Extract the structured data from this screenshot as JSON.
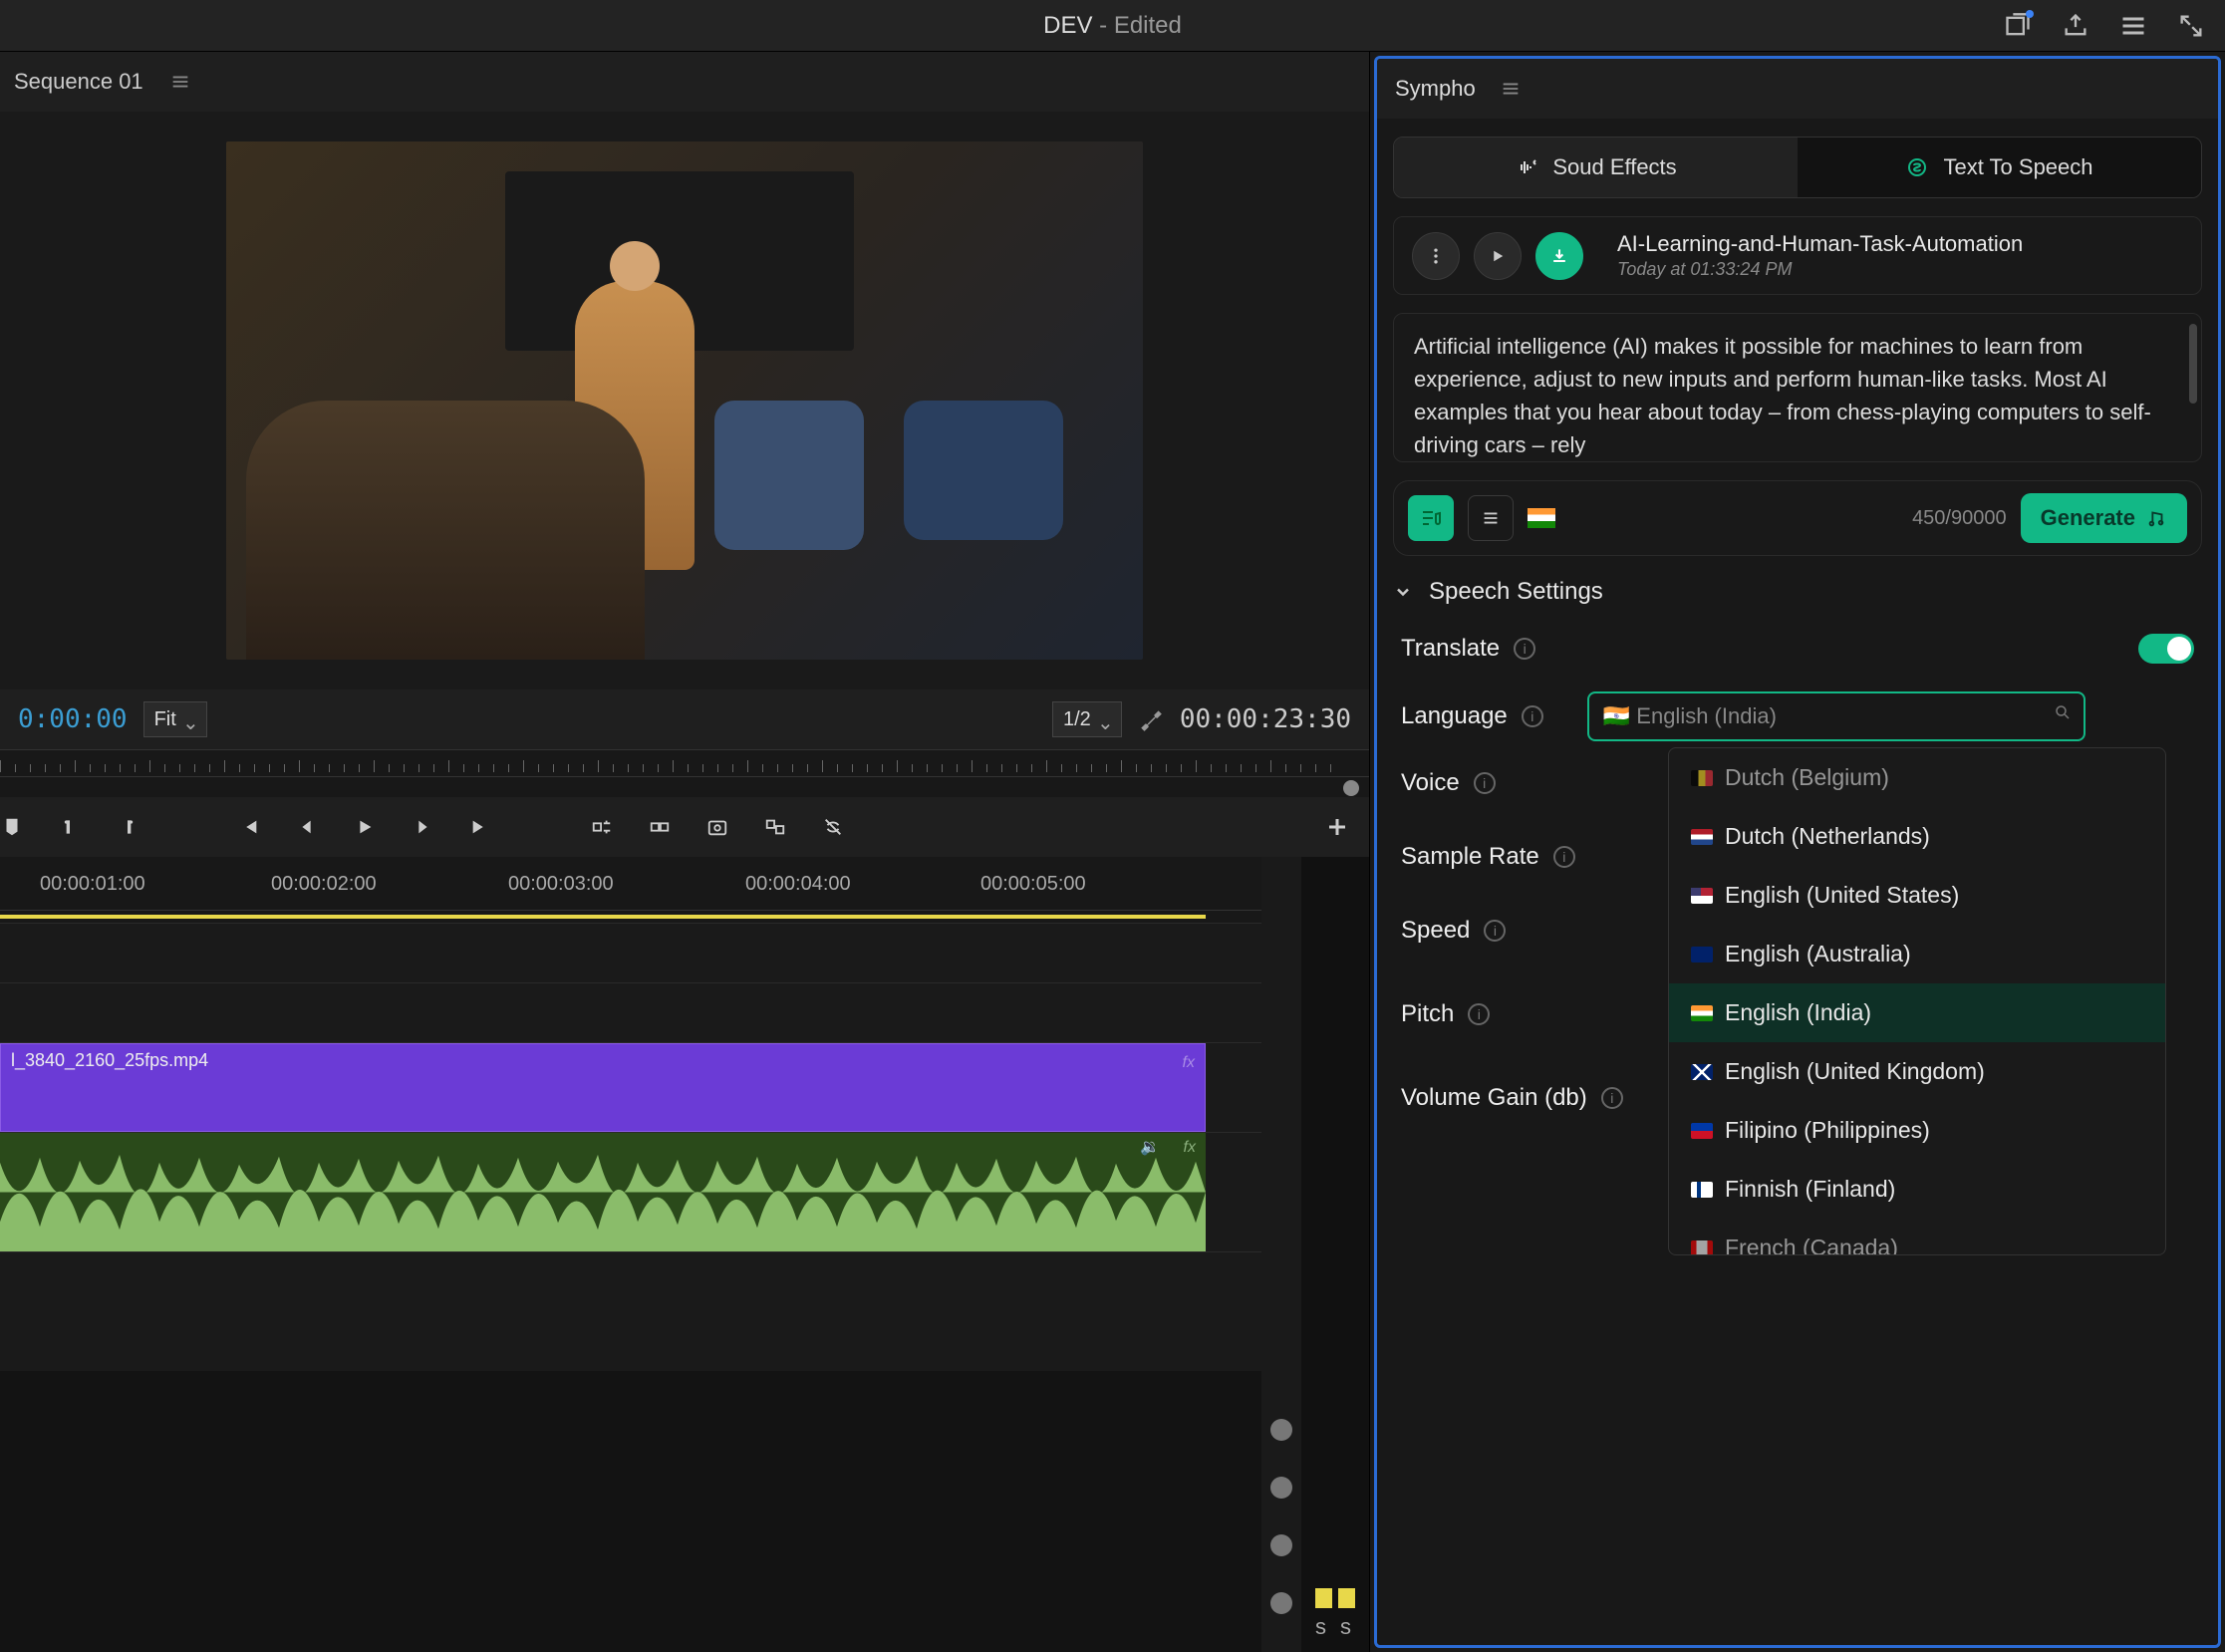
{
  "title": {
    "primary": "DEV",
    "suffix": " - Edited"
  },
  "left": {
    "sequence_label": "Sequence 01",
    "tc_start": "0:00:00",
    "fit_label": "Fit",
    "page_label": "1/2",
    "tc_end": "00:00:23:30",
    "time_labels": [
      "00:00:01:00",
      "00:00:02:00",
      "00:00:03:00",
      "00:00:04:00",
      "00:00:05:00"
    ],
    "video_clip_name": "l_3840_2160_25fps.mp4",
    "fx_label": "fx",
    "vu_label": "s  s"
  },
  "panel": {
    "name": "Sympho",
    "tabs": {
      "sound_effects": "Soud Effects",
      "tts": "Text To Speech"
    },
    "asset": {
      "title": "AI-Learning-and-Human-Task-Automation",
      "time": "Today at 01:33:24 PM"
    },
    "body_text": "Artificial intelligence (AI) makes it possible for machines to learn from experience, adjust to new inputs and perform human-like tasks. Most AI examples that you hear about today – from chess-playing computers to self-driving cars – rely",
    "char_count": "450/90000",
    "generate_label": "Generate",
    "speech_settings": "Speech Settings",
    "translate": "Translate",
    "language": "Language",
    "lang_value": "🇮🇳 English (India)",
    "voice": "Voice",
    "sample_rate": "Sample Rate",
    "speed": "Speed",
    "pitch": "Pitch",
    "volume_gain": "Volume Gain (db)",
    "lang_options": [
      {
        "flag": "be",
        "label": "Dutch (Belgium)",
        "cut": true
      },
      {
        "flag": "nl",
        "label": "Dutch (Netherlands)"
      },
      {
        "flag": "us",
        "label": "English (United States)"
      },
      {
        "flag": "au",
        "label": "English (Australia)"
      },
      {
        "flag": "in",
        "label": "English (India)",
        "hl": true
      },
      {
        "flag": "gb",
        "label": "English (United Kingdom)"
      },
      {
        "flag": "ph",
        "label": "Filipino (Philippines)"
      },
      {
        "flag": "fi",
        "label": "Finnish (Finland)"
      },
      {
        "flag": "ca",
        "label": "French (Canada)",
        "cut": true
      }
    ]
  }
}
